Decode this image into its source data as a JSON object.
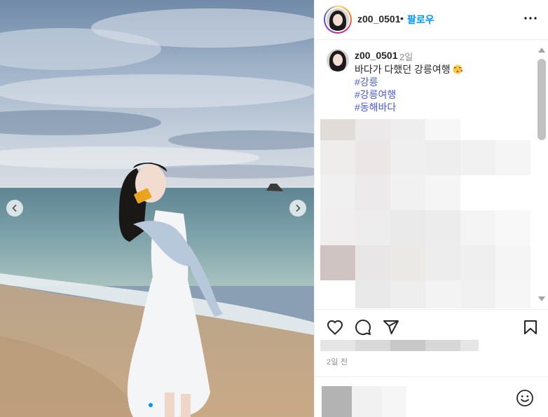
{
  "post": {
    "author": "z00_0501",
    "separator": "•",
    "follow_label": "팔로우",
    "caption": {
      "time": "2일",
      "text": "바다가 다했던 강릉여행",
      "emoji": "kiss-face-emoji",
      "hashtags": [
        "#강릉",
        "#강릉여행",
        "#동해바다"
      ]
    },
    "posted_ago": "2일 전"
  },
  "carousel": {
    "slide_count": 2,
    "active_index": 0
  },
  "icons": {
    "more": "more-options-icon",
    "prev": "chevron-left-icon",
    "next": "chevron-right-icon",
    "like": "heart-icon",
    "comment": "comment-bubble-icon",
    "share": "paper-plane-icon",
    "save": "bookmark-icon",
    "emoji": "smiley-icon"
  },
  "colors": {
    "accent": "#0095f6",
    "hashtag": "#4a5bd4",
    "text": "#262626",
    "muted": "#8e8e8e"
  }
}
